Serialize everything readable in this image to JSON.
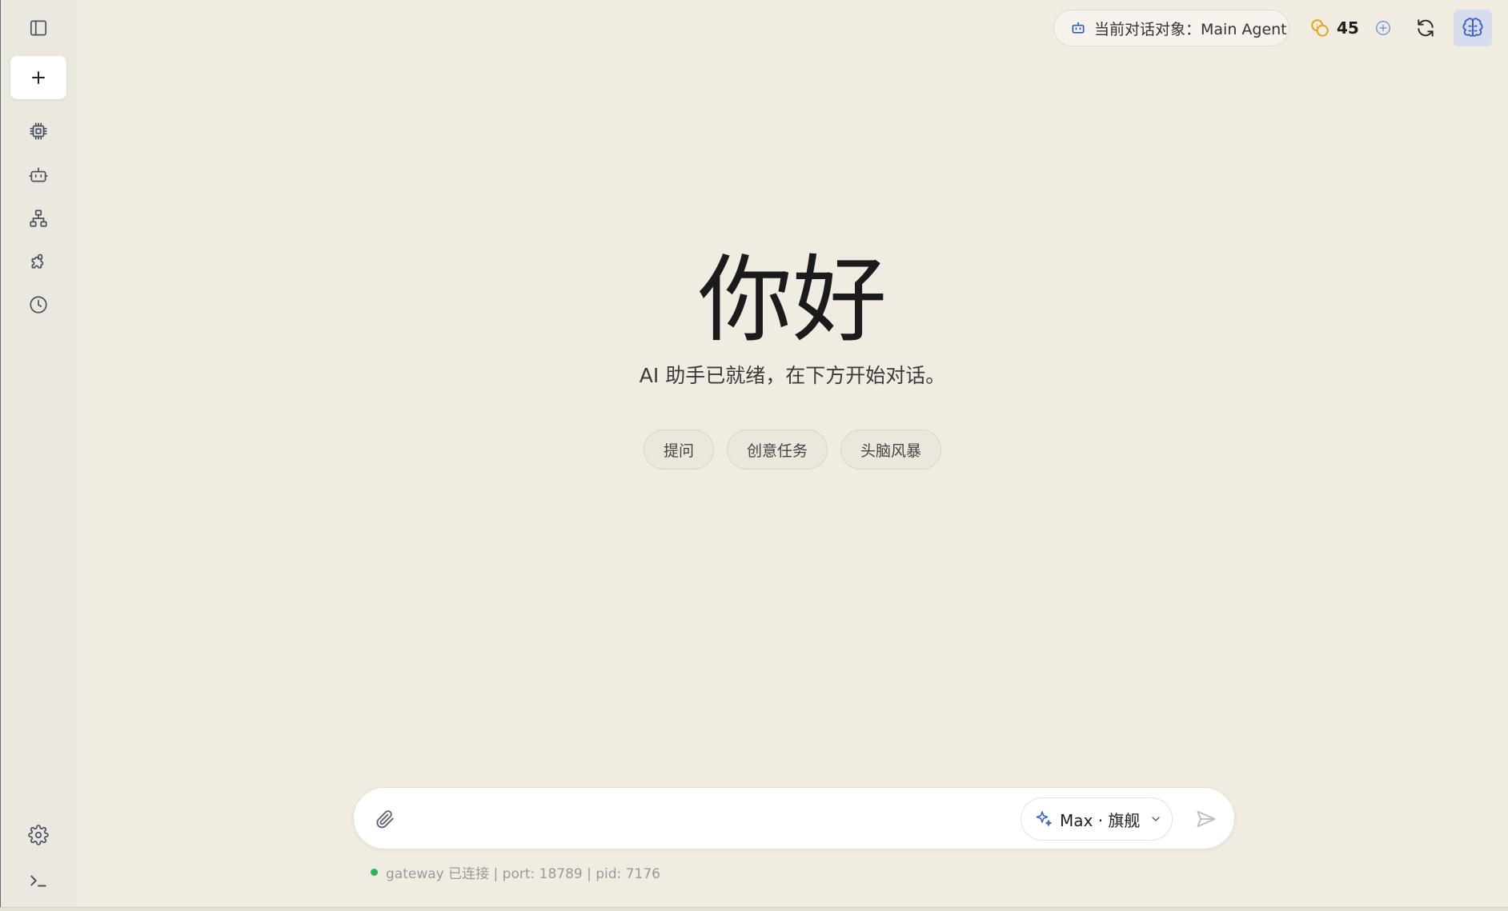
{
  "sidebar": {
    "items": [
      {
        "name": "toggle-sidebar",
        "icon": "sidebar-panel-icon"
      },
      {
        "name": "new-chat",
        "icon": "plus-icon"
      },
      {
        "name": "models",
        "icon": "chip-icon"
      },
      {
        "name": "agents",
        "icon": "robot-icon"
      },
      {
        "name": "workflow",
        "icon": "hierarchy-icon"
      },
      {
        "name": "plugins",
        "icon": "puzzle-icon"
      },
      {
        "name": "history",
        "icon": "clock-icon"
      },
      {
        "name": "settings",
        "icon": "gear-icon"
      },
      {
        "name": "terminal",
        "icon": "terminal-icon"
      }
    ]
  },
  "header": {
    "agent_label": "当前对话对象：Main Agent",
    "coin_count": "45"
  },
  "hero": {
    "title": "你好",
    "subtitle": "AI 助手已就绪，在下方开始对话。",
    "chips": [
      "提问",
      "创意任务",
      "头脑风暴"
    ]
  },
  "composer": {
    "placeholder": "",
    "model_label": "Max · 旗舰"
  },
  "status": {
    "text": "gateway 已连接 | port: 18789 | pid: 7176",
    "color": "#2fb45e"
  },
  "colors": {
    "background": "#f0ece1",
    "sidebar": "#ebe8df",
    "accent": "#3c63c8"
  }
}
